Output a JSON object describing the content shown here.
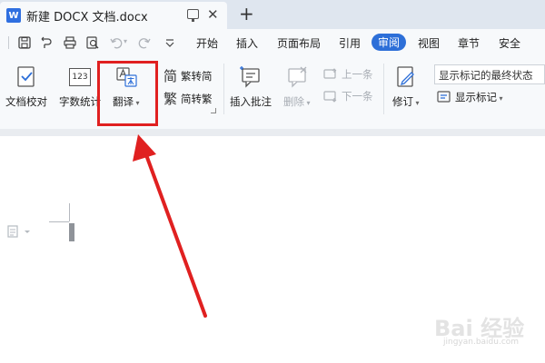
{
  "window": {
    "tab_title": "新建 DOCX 文档.docx",
    "app_logo": "W",
    "close_glyph": "✕",
    "new_tab_glyph": "+"
  },
  "menu": {
    "tabs": [
      {
        "label": "开始"
      },
      {
        "label": "插入"
      },
      {
        "label": "页面布局"
      },
      {
        "label": "引用"
      },
      {
        "label": "审阅",
        "active": true
      },
      {
        "label": "视图"
      },
      {
        "label": "章节"
      },
      {
        "label": "安全"
      }
    ],
    "quick_access_icons": [
      "save-icon",
      "undo-history-icon",
      "print-icon",
      "print-preview-icon",
      "undo-icon",
      "redo-icon",
      "customize-icon"
    ]
  },
  "ribbon": {
    "proofread": "文档校对",
    "word_count": "字数统计",
    "translate": "翻译",
    "trad_to_simp": "繁转简",
    "simp_to_trad": "简转繁",
    "insert_comment": "插入批注",
    "delete": "删除",
    "previous": "上一条",
    "next": "下一条",
    "track_changes": "修订",
    "display_markup_state": "显示标记的最终状态",
    "show_markup": "显示标记",
    "word_count_icon_text": "123",
    "trad_char": "简",
    "simp_char": "繁"
  },
  "watermark": {
    "main": "Bai 经验",
    "sub": "jingyan.baidu.com"
  },
  "colors": {
    "accent": "#2d6fd8",
    "highlight": "#e02020",
    "titlebar": "#dfe6ef"
  }
}
